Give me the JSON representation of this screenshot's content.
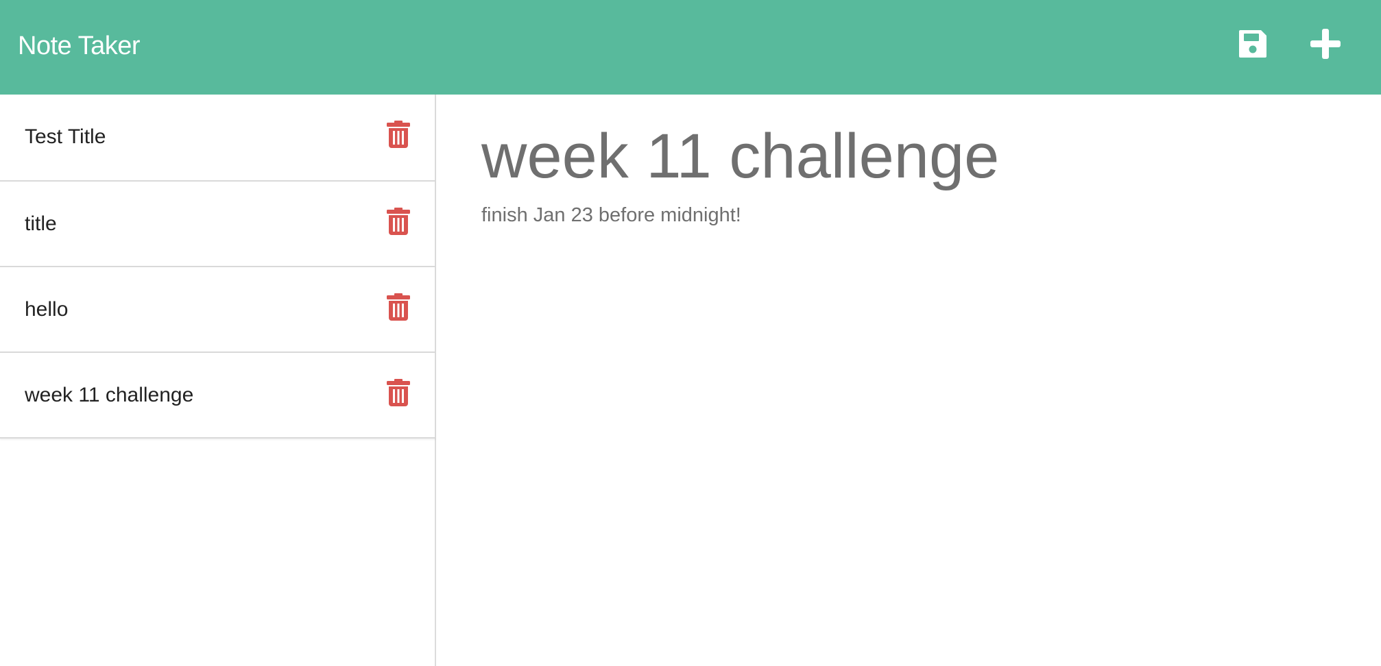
{
  "app": {
    "title": "Note Taker"
  },
  "toolbar": {
    "save_icon": "floppy-disk-icon",
    "new_icon": "plus-icon"
  },
  "colors": {
    "navbar": "#58ba9c",
    "delete": "#d9534f",
    "text_muted": "#6f6f6f"
  },
  "notes": [
    {
      "title": "Test Title",
      "icon": "trash-icon"
    },
    {
      "title": "title",
      "icon": "trash-icon"
    },
    {
      "title": "hello",
      "icon": "trash-icon"
    },
    {
      "title": "week 11 challenge",
      "icon": "trash-icon"
    }
  ],
  "active_note": {
    "title": "week 11 challenge",
    "text": "finish Jan 23 before midnight!"
  }
}
